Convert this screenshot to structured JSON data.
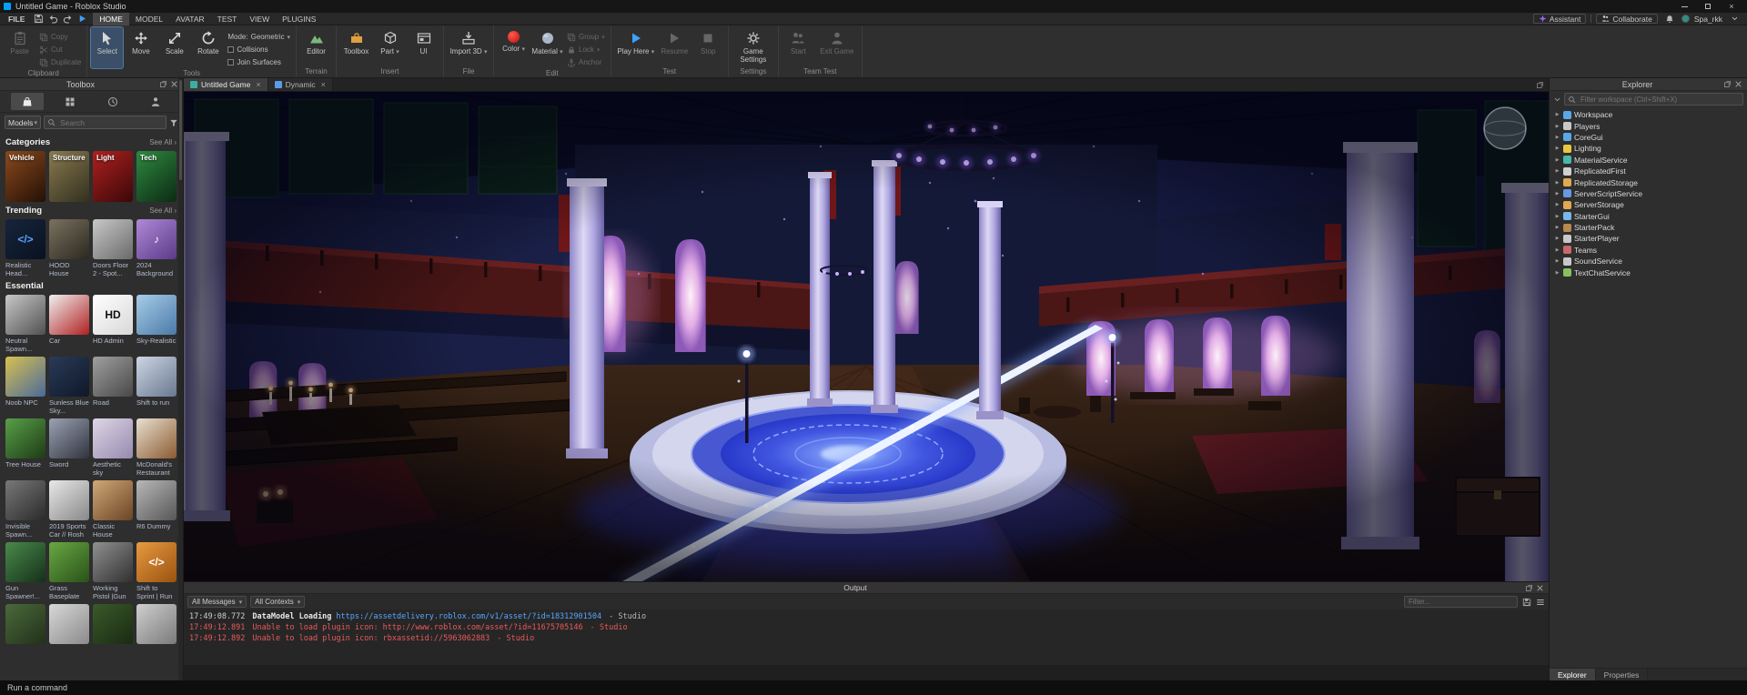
{
  "window": {
    "title": "Untitled Game - Roblox Studio"
  },
  "menubar": {
    "file": "FILE",
    "tabs": [
      {
        "label": "HOME",
        "active": true
      },
      {
        "label": "MODEL"
      },
      {
        "label": "AVATAR"
      },
      {
        "label": "TEST"
      },
      {
        "label": "VIEW"
      },
      {
        "label": "PLUGINS"
      }
    ],
    "assistant": "Assistant",
    "collaborate": "Collaborate",
    "username": "Spa_rkk"
  },
  "ribbon": {
    "clipboard": {
      "label": "Clipboard",
      "paste": "Paste",
      "copy": "Copy",
      "cut": "Cut",
      "duplicate": "Duplicate"
    },
    "tools": {
      "label": "Tools",
      "select": "Select",
      "move": "Move",
      "scale": "Scale",
      "rotate": "Rotate",
      "mode_label": "Mode:",
      "mode_value": "Geometric",
      "collisions": "Collisions",
      "join_surfaces": "Join Surfaces"
    },
    "terrain": {
      "label": "Terrain",
      "editor": "Editor"
    },
    "insert": {
      "label": "Insert",
      "toolbox": "Toolbox",
      "part": "Part",
      "ui": "UI"
    },
    "file": {
      "label": "File",
      "import_3d": "Import 3D"
    },
    "edit": {
      "label": "Edit",
      "color": "Color",
      "material": "Material",
      "group": "Group",
      "lock": "Lock",
      "anchor": "Anchor"
    },
    "test": {
      "label": "Test",
      "play_here": "Play Here",
      "resume": "Resume",
      "stop": "Stop"
    },
    "settings": {
      "label": "Settings",
      "game_settings": "Game Settings"
    },
    "team_test": {
      "label": "Team Test",
      "start": "Start",
      "exit_game": "Exit Game"
    }
  },
  "toolbox": {
    "title": "Toolbox",
    "dropdown_value": "Models",
    "search_placeholder": "Search",
    "categories_title": "Categories",
    "trending_title": "Trending",
    "essential_title": "Essential",
    "see_all": "See All ›",
    "categories": [
      {
        "label": "Vehicle",
        "c1": "#8a4a1e",
        "c2": "#241005"
      },
      {
        "label": "Structure",
        "c1": "#8a7a50",
        "c2": "#32301e"
      },
      {
        "label": "Light",
        "c1": "#b02020",
        "c2": "#3a0808"
      },
      {
        "label": "Tech",
        "c1": "#2e8a40",
        "c2": "#0c2a14"
      }
    ],
    "trending": [
      {
        "label": "Realistic Head...",
        "c1": "#16243c",
        "c2": "#0a1220",
        "text": "</>",
        "text_color": "#58a6ff"
      },
      {
        "label": "HOOD House",
        "c1": "#7a7260",
        "c2": "#2c2820"
      },
      {
        "label": "Doors Floor 2 - Spot...",
        "c1": "#c8c8c8",
        "c2": "#6a6a6a"
      },
      {
        "label": "2024 Background",
        "c1": "#b089d8",
        "c2": "#5a3a88",
        "text": "♪",
        "text_color": "#ffffff"
      }
    ],
    "essential": [
      {
        "label": "Neutral Spawn...",
        "c1": "#c8c8c8",
        "c2": "#505050"
      },
      {
        "label": "Car",
        "c1": "#f0f0f0",
        "c2": "#b02020"
      },
      {
        "label": "HD Admin",
        "c1": "#ffffff",
        "c2": "#d8d8d8",
        "text": "HD",
        "text_color": "#111111"
      },
      {
        "label": "Sky-Realistic",
        "c1": "#a8cce8",
        "c2": "#4a7aa8"
      },
      {
        "label": "Noob NPC",
        "c1": "#d8c050",
        "c2": "#4a6a9a"
      },
      {
        "label": "Sunless Blue Sky...",
        "c1": "#2a3a58",
        "c2": "#0e1828"
      },
      {
        "label": "Road",
        "c1": "#a0a0a0",
        "c2": "#484848"
      },
      {
        "label": "Shift to run",
        "c1": "#cdd6e4",
        "c2": "#68788e"
      },
      {
        "label": "Tree House",
        "c1": "#58a048",
        "c2": "#1e3a16"
      },
      {
        "label": "Sword",
        "c1": "#9aa2b2",
        "c2": "#30343e"
      },
      {
        "label": "Aesthetic sky",
        "c1": "#ded6e6",
        "c2": "#968aae"
      },
      {
        "label": "McDonald's Restaurant",
        "c1": "#e8e0d0",
        "c2": "#8a5a30"
      },
      {
        "label": "Invisible Spawn...",
        "c1": "#787878",
        "c2": "#2a2a2a"
      },
      {
        "label": "2019 Sports Car // Rosh",
        "c1": "#e8e8e8",
        "c2": "#888888"
      },
      {
        "label": "Classic House",
        "c1": "#d0a878",
        "c2": "#6a4424"
      },
      {
        "label": "R6 Dummy",
        "c1": "#b8b8b8",
        "c2": "#565656"
      },
      {
        "label": "Gun Spawner!...",
        "c1": "#4a8a4a",
        "c2": "#14301a"
      },
      {
        "label": "Grass Baseplate",
        "c1": "#68a844",
        "c2": "#2a5218"
      },
      {
        "label": "Working Pistol |Gun",
        "c1": "#909090",
        "c2": "#303030"
      },
      {
        "label": "Shift to Sprint | Run",
        "c1": "#e89a40",
        "c2": "#9a5210",
        "text": "</>",
        "text_color": "#ffffff"
      },
      {
        "label": "",
        "c1": "#4a6a3a",
        "c2": "#22301a"
      },
      {
        "label": "",
        "c1": "#d8d8d8",
        "c2": "#8a8a8a"
      },
      {
        "label": "",
        "c1": "#3a5a2a",
        "c2": "#1a2a12"
      },
      {
        "label": "",
        "c1": "#cfcfcf",
        "c2": "#7a7a7a"
      }
    ]
  },
  "doc_tabs": [
    {
      "label": "Untitled Game",
      "active": true,
      "icon_color": "#3ab0a0"
    },
    {
      "label": "Dynamic",
      "active": false,
      "icon_color": "#5a9ae8"
    }
  ],
  "explorer": {
    "title": "Explorer",
    "filter_placeholder": "Filter workspace (Ctrl+Shift+X)",
    "items": [
      {
        "label": "Workspace",
        "icon": "workspace-icon",
        "color": "#5aa8e8",
        "arrow": true
      },
      {
        "label": "Players",
        "icon": "players-icon",
        "color": "#c8c8c8",
        "arrow": true
      },
      {
        "label": "CoreGui",
        "icon": "coregui-icon",
        "color": "#5aa8e8",
        "arrow": true
      },
      {
        "label": "Lighting",
        "icon": "lighting-icon",
        "color": "#e8c840",
        "arrow": true
      },
      {
        "label": "MaterialService",
        "icon": "material-service-icon",
        "color": "#48b8a8",
        "arrow": true
      },
      {
        "label": "ReplicatedFirst",
        "icon": "replicated-first-icon",
        "color": "#d0d0d0",
        "arrow": true
      },
      {
        "label": "ReplicatedStorage",
        "icon": "replicated-storage-icon",
        "color": "#e0a850",
        "arrow": true
      },
      {
        "label": "ServerScriptService",
        "icon": "server-script-service-icon",
        "color": "#6898e0",
        "arrow": true
      },
      {
        "label": "ServerStorage",
        "icon": "server-storage-icon",
        "color": "#e0a850",
        "arrow": true
      },
      {
        "label": "StarterGui",
        "icon": "starter-gui-icon",
        "color": "#78b8e8",
        "arrow": true
      },
      {
        "label": "StarterPack",
        "icon": "starter-pack-icon",
        "color": "#b88a50",
        "arrow": true
      },
      {
        "label": "StarterPlayer",
        "icon": "starter-player-icon",
        "color": "#c8c8c8",
        "arrow": true
      },
      {
        "label": "Teams",
        "icon": "teams-icon",
        "color": "#c86868",
        "arrow": true
      },
      {
        "label": "SoundService",
        "icon": "sound-service-icon",
        "color": "#c8c8c8",
        "arrow": true
      },
      {
        "label": "TextChatService",
        "icon": "text-chat-service-icon",
        "color": "#88c060",
        "arrow": true
      }
    ],
    "bottom_tabs": [
      {
        "label": "Explorer",
        "active": true
      },
      {
        "label": "Properties",
        "active": false
      }
    ]
  },
  "output": {
    "title": "Output",
    "messages_dropdown": "All Messages",
    "contexts_dropdown": "All Contexts",
    "filter_placeholder": "Filter...",
    "logs": [
      {
        "time": "17:49:08.772",
        "message": "DataModel Loading",
        "url": "https://assetdelivery.roblox.com/v1/asset/?id=18312901504",
        "suffix": "-  Studio",
        "type": "info"
      },
      {
        "time": "17:49:12.891",
        "message": "Unable to load plugin icon:",
        "url": "http://www.roblox.com/asset/?id=11675705146",
        "suffix": "-  Studio",
        "type": "error"
      },
      {
        "time": "17:49:12.892",
        "message": "Unable to load plugin icon:",
        "url": "rbxassetid://5963062883",
        "suffix": "-  Studio",
        "type": "error"
      }
    ]
  },
  "statusbar": {
    "text": "Run a command"
  },
  "colors": {
    "accent_play": "#3da1ff",
    "error": "#e85a5a",
    "link": "#58a6ff"
  }
}
